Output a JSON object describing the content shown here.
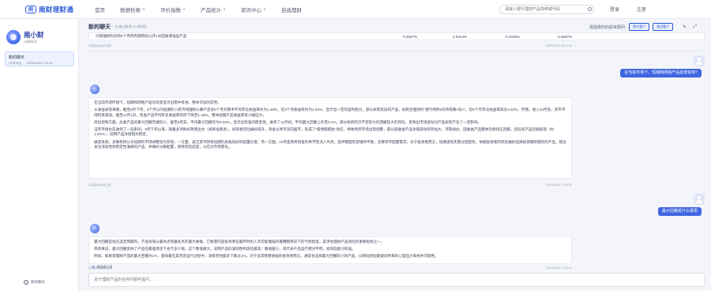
{
  "topnav": {
    "logo_mark": "网",
    "logo_text": "南财理财通",
    "items": [
      {
        "label": "首页",
        "dropdown": false
      },
      {
        "label": "数据检索",
        "dropdown": true
      },
      {
        "label": "评价指数",
        "dropdown": true
      },
      {
        "label": "产品统计",
        "dropdown": true
      },
      {
        "label": "资讯中心",
        "dropdown": true
      },
      {
        "label": "自选理财",
        "dropdown": false
      }
    ],
    "search_placeholder": "请输入银行理财产品简称或代码",
    "right_items": [
      "登录",
      "注册"
    ]
  },
  "sidebar": {
    "brand_name": "南小财",
    "brand_sub": "AI理财助手",
    "chat_item": {
      "title": "新的聊天",
      "count": "10 条对话",
      "time": "2025/10/26 17:01:41"
    },
    "new_chat_label": "新的聊天"
  },
  "header": {
    "title": "新的聊天",
    "meta": "与 南小财 的 10 条对话",
    "prompt_label": "请选择你的投资顾问:",
    "advisors": [
      "保守客户",
      "激进客户"
    ],
    "icons": [
      "edit-icon",
      "expand-icon"
    ]
  },
  "table": {
    "row": [
      "兴银理财利润的5个月持有期持续公开1号固收增强型产品",
      "0.3557%",
      "2.6344%",
      "0.2330%",
      "0.0667%"
    ]
  },
  "messages": {
    "meta_label": "内容由AI技术生成",
    "time1": "2025/10/26 16:41:30",
    "user1": "在当前市场下，短期和网络产品前景如何?",
    "bot1": [
      "在当前市场环境下，短期和网络产品的前景显示出稳中有进，整体可加的态势。",
      "从收益表现来看，截至8月下旬，3个月以内短期的人民币纯理财公募产品近6个月的算术平均年化收益率约为1.28%，近3个月收益率约为1.24%，显示出一定的盈利能力。部分表现优异的产品，如民生理财的“富竹纯债9天持有期4号A”，近6个月年化收益率高达3.32%。然而，进入10月后，货币市场利率波动，截至11月1日，现金产品平均年化收益率有所下降至1.15%，整体短期产品收益率有小幅压力。",
      "风险控制方面，此类产品的最大回撤普遍较小，截至8月末，平均最大回撤仅为0.03%，显示出较强的稳定性。进到了11月初，平均最大回撤上升至0.1%，部分机构仍仍不定较大的回撤较大的风险，反映出市场波动对产品表现产生了一定影响。",
      "证券市场也在收到了一些影响，9月下旬以来，随着多项利好政策出台（如降准降息），投资者风险偏好提升，资金从债市流向股市，形成了“股债跷跷板”效应，导致债券市场出现调整，部分固收类产品净值波动有所加大。尽管如此，固收类产品整体仍保持正回报，且较多产品近期表现（约1.02%），说明产品净值相对稳定。",
      "展望未来，多数机构认为短期的市场调整较为有限。一方面，美元货币政策短期仍具备较好的配置价值；另一方面，10月是债券资金的季节性流入时点，且供需面有望维持平衡，支撑货币配置需求。对于投资者而言，短期波动无需过度担忧，依据投资者的风险偏好选择投资期限相符的产品。建议关注流动性和稳定性兼顾的产品，并做好分散配置，保持风险适度，以应对市场变化。"
    ],
    "time2": "2025/10/26 17:00:53",
    "user2": "最大回撤是什么意思",
    "bot2": [
      "最大回撤是指在选定周期内，产品净值从最高点到最低点的最大跌幅。它衡量的是投资者在最坏时机入市可能面临的最糟糕情况下的亏损程度，是评估理财产品风险的重要指标之一。",
      "简单来说，最大回撤反映了产品在最差情况下会亏多少钱。这个数值越大，说明产品的波动性和风险越高；数值越小，则代表产品运行相对平稳，抗风险能力较强。",
      "例如，如果某理财产品的最大回撤为1%，意味着在其历史运行过程中，净值曾经最多下跌过1%。对于追求稳健收益的投资者而言，通常会选择最大回撤较小的产品，以降低因短期波动带来的心理压力和损失可能性。"
    ],
    "time3": "2025/10/26 17:01:41"
  },
  "input": {
    "hint": "常用提示语",
    "placeholder": "关于理财产品的任何问题可提问..."
  }
}
